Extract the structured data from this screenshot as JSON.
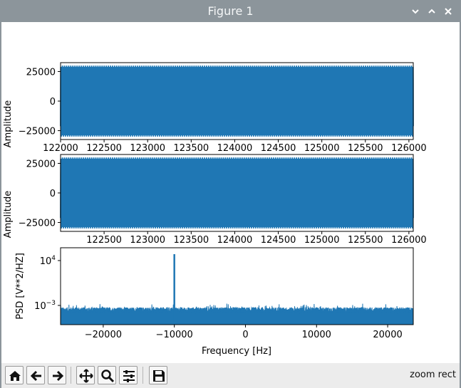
{
  "window": {
    "title": "Figure 1"
  },
  "toolbar": {
    "buttons": [
      "home-icon",
      "back-icon",
      "forward-icon",
      "pan-icon",
      "zoom-icon",
      "configure-subplots-icon",
      "save-icon"
    ],
    "status": "zoom rect"
  },
  "colors": {
    "line": "#1f77b4",
    "titlebar": "#8c959b",
    "toolbar": "#ececec"
  },
  "chart_data": [
    {
      "type": "line",
      "series": [
        {
          "frequency_hz": 10000,
          "amplitude": 30000,
          "sample_rate_hz": 48000
        }
      ],
      "xlim": [
        122000,
        126050
      ],
      "ylim": [
        -32500,
        32500
      ],
      "xticks": [
        "122000",
        "122500",
        "123000",
        "123500",
        "124000",
        "124500",
        "125000",
        "125500",
        "126000"
      ],
      "yticks": [
        "25000",
        "0",
        "−25000"
      ],
      "ylabel": "Amplitude",
      "xlabel": ""
    },
    {
      "type": "line",
      "series": [
        {
          "frequency_hz": 10000,
          "amplitude": 30000,
          "sample_rate_hz": 48000
        }
      ],
      "xlim": [
        122000,
        126050
      ],
      "ylim": [
        -32500,
        32500
      ],
      "xticks": [
        "122500",
        "123000",
        "123500",
        "124000",
        "124500",
        "125000",
        "125500",
        "126000"
      ],
      "yticks": [
        "25000",
        "0",
        "−25000"
      ],
      "ylabel": "Amplitude",
      "xlabel": ""
    },
    {
      "type": "line",
      "y_scale": "log",
      "xlim": [
        -26000,
        23600
      ],
      "xticks": [
        "−20000",
        "−10000",
        "0",
        "10000",
        "20000"
      ],
      "ytick_labels": [
        {
          "base": "10",
          "exp": "4"
        },
        {
          "base": "10",
          "exp": "−3"
        }
      ],
      "ylabel": "PSD [V**2/HZ]",
      "xlabel": "Frequency [Hz]",
      "peak_frequency_hz": -10000
    }
  ]
}
